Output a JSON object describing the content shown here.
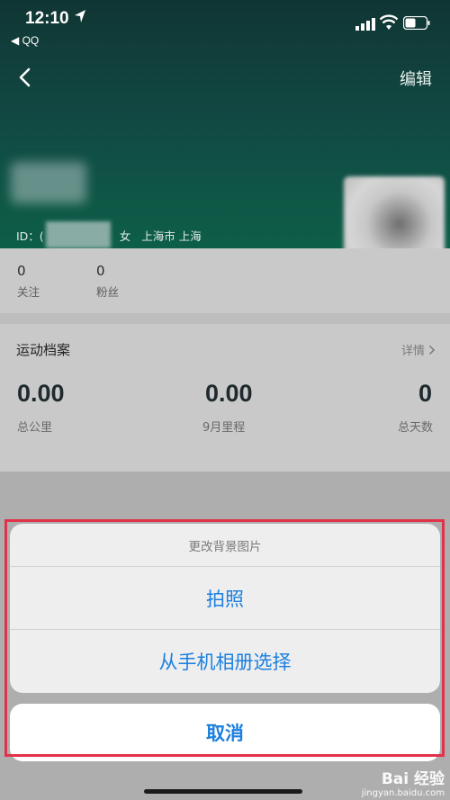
{
  "status_bar": {
    "time": "12:10",
    "back_app": "◀ QQ"
  },
  "nav": {
    "edit_label": "编辑"
  },
  "profile": {
    "id_prefix": "ID：(",
    "gender": "女",
    "location": "上海市 上海"
  },
  "stats": [
    {
      "value": "0",
      "label": "关注"
    },
    {
      "value": "0",
      "label": "粉丝"
    }
  ],
  "sport": {
    "title": "运动档案",
    "detail_label": "详情",
    "metrics": [
      {
        "value": "0.00",
        "label": "总公里"
      },
      {
        "value": "0.00",
        "label": "9月里程"
      },
      {
        "value": "0",
        "label": "总天数"
      }
    ]
  },
  "action_sheet": {
    "title": "更改背景图片",
    "options": [
      "拍照",
      "从手机相册选择"
    ],
    "cancel_label": "取消"
  },
  "watermark": {
    "brand": "Bai 经验",
    "site": "jingyan.baidu.com"
  },
  "colors": {
    "header": "#14504a",
    "accent": "#1a7fe0",
    "highlight": "#e2324a"
  }
}
